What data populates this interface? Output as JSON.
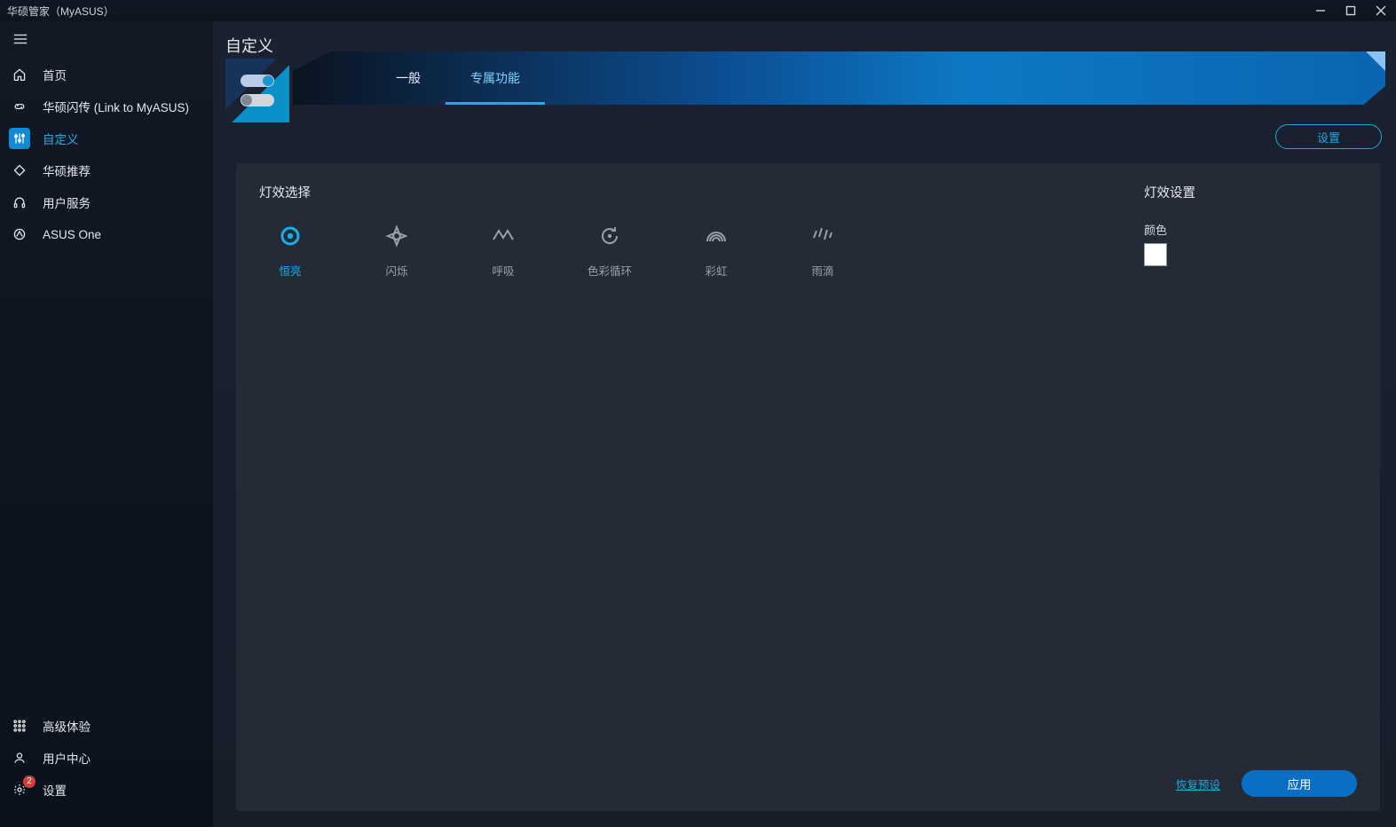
{
  "app_title": "华硕管家（MyASUS）",
  "sidebar": {
    "items": [
      {
        "label": "首页"
      },
      {
        "label": "华硕闪传 (Link to MyASUS)"
      },
      {
        "label": "自定义"
      },
      {
        "label": "华硕推荐"
      },
      {
        "label": "用户服务"
      },
      {
        "label": "ASUS One"
      }
    ],
    "bottom": [
      {
        "label": "高级体验"
      },
      {
        "label": "用户中心"
      },
      {
        "label": "设置",
        "badge": "2"
      }
    ]
  },
  "page": {
    "title": "自定义",
    "tabs": [
      {
        "label": "一般"
      },
      {
        "label": "专属功能"
      }
    ],
    "settings_button": "设置"
  },
  "panel": {
    "effects_title": "灯效选择",
    "effects": [
      {
        "label": "恒亮"
      },
      {
        "label": "闪烁"
      },
      {
        "label": "呼吸"
      },
      {
        "label": "色彩循环"
      },
      {
        "label": "彩虹"
      },
      {
        "label": "雨滴"
      }
    ],
    "settings_title": "灯效设置",
    "color_label": "颜色",
    "color_value": "#FFFFFF",
    "reset_label": "恢复预设",
    "apply_label": "应用"
  }
}
